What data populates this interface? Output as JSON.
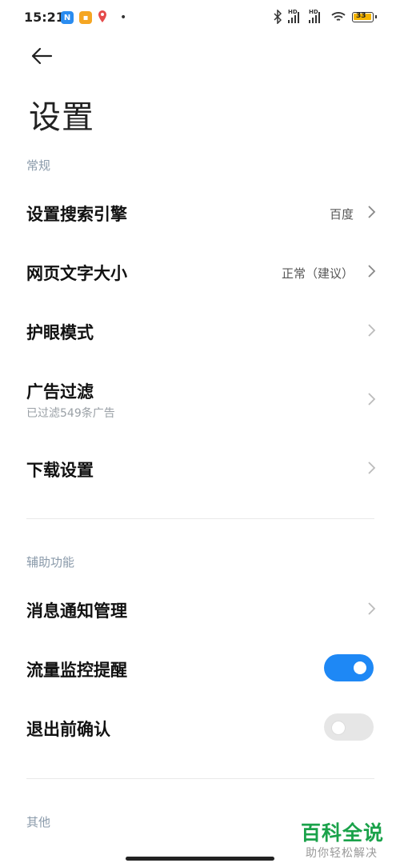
{
  "status_bar": {
    "time": "15:21",
    "app_icons": [
      "n-app-icon",
      "orange-app-icon",
      "location-pin-icon"
    ],
    "dot": "•",
    "battery_level": "33",
    "network": [
      "HD",
      "HD"
    ]
  },
  "header": {
    "title": "设置"
  },
  "sections": {
    "general": {
      "label": "常规",
      "items": [
        {
          "label": "设置搜索引擎",
          "value": "百度"
        },
        {
          "label": "网页文字大小",
          "value": "正常（建议）"
        },
        {
          "label": "护眼模式",
          "value": ""
        },
        {
          "label": "广告过滤",
          "sub": "已过滤549条广告"
        },
        {
          "label": "下载设置",
          "value": ""
        }
      ]
    },
    "accessibility": {
      "label": "辅助功能",
      "items": [
        {
          "label": "消息通知管理"
        },
        {
          "label": "流量监控提醒",
          "toggle": true
        },
        {
          "label": "退出前确认",
          "toggle": false
        }
      ]
    },
    "other": {
      "label": "其他"
    }
  },
  "watermark": {
    "main": "百科全说",
    "sub": "助你轻松解决"
  },
  "colors": {
    "accent": "#1e88f5",
    "watermark": "#1aa24a"
  }
}
